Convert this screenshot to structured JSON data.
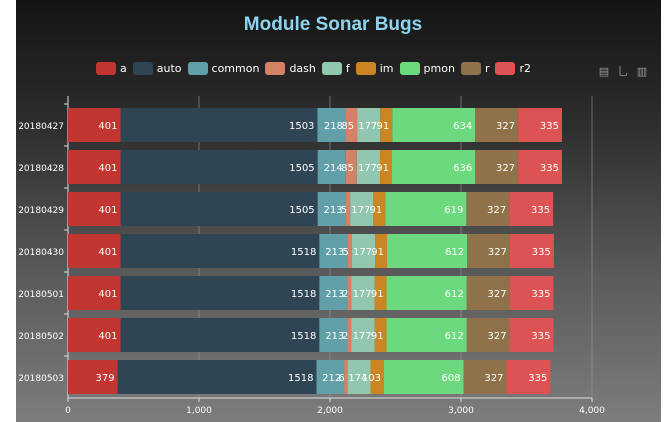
{
  "title": "Module Sonar Bugs",
  "toolbox": [
    {
      "name": "data-view-icon",
      "glyph": "▤"
    },
    {
      "name": "line-chart-icon",
      "glyph": "⺃"
    },
    {
      "name": "bar-chart-icon",
      "glyph": "▥"
    }
  ],
  "chart_data": {
    "type": "bar",
    "orientation": "horizontal",
    "stacked": true,
    "title": "Module Sonar Bugs",
    "categories": [
      "20180427",
      "20180428",
      "20180429",
      "20180430",
      "20180501",
      "20180502",
      "20180503"
    ],
    "xlim": [
      0,
      4000
    ],
    "x_ticks": [
      "0",
      "1,000",
      "2,000",
      "3,000",
      "4,000"
    ],
    "grid": true,
    "legend_position": "top",
    "series": [
      {
        "name": "a",
        "color": "#c23531",
        "values": [
          401,
          401,
          401,
          401,
          401,
          401,
          379
        ],
        "labels": [
          "401",
          "401",
          "401",
          "401",
          "401",
          "401",
          "379"
        ]
      },
      {
        "name": "auto",
        "color": "#2f4554",
        "values": [
          1503,
          1505,
          1505,
          1518,
          1518,
          1518,
          1518
        ],
        "labels": [
          "1503",
          "1505",
          "1505",
          "1518",
          "1518",
          "1518",
          "1518"
        ]
      },
      {
        "name": "common",
        "color": "#61a0a8",
        "values": [
          218,
          214,
          213,
          213,
          213,
          213,
          212
        ],
        "labels": [
          "218",
          "214",
          "213",
          "213",
          "213",
          "213",
          "212"
        ]
      },
      {
        "name": "dash",
        "color": "#d48265",
        "values": [
          85,
          85,
          35,
          35,
          32,
          32,
          26
        ],
        "labels": [
          "85",
          "85",
          "5",
          "5",
          "2",
          "2",
          "6"
        ]
      },
      {
        "name": "f",
        "color": "#91c7ae",
        "values": [
          177,
          177,
          177,
          177,
          177,
          177,
          174
        ],
        "labels": [
          "177",
          "177",
          "177",
          "177",
          "177",
          "177",
          "174"
        ]
      },
      {
        "name": "im",
        "color": "#ca8622",
        "values": [
          91,
          91,
          91,
          91,
          91,
          91,
          103
        ],
        "labels": [
          "91",
          "91",
          "91",
          "91",
          "91",
          "91",
          "103"
        ]
      },
      {
        "name": "pmon",
        "color": "#6cd97e",
        "values": [
          634,
          636,
          619,
          612,
          612,
          612,
          608
        ],
        "labels": [
          "634",
          "636",
          "619",
          "612",
          "612",
          "612",
          "608"
        ]
      },
      {
        "name": "r",
        "color": "#8f7249",
        "values": [
          327,
          327,
          327,
          327,
          327,
          327,
          327
        ],
        "labels": [
          "327",
          "327",
          "327",
          "327",
          "327",
          "327",
          "327"
        ]
      },
      {
        "name": "r2",
        "color": "#dd5353",
        "values": [
          335,
          335,
          335,
          335,
          335,
          335,
          335
        ],
        "labels": [
          "335",
          "335",
          "335",
          "335",
          "335",
          "335",
          "335"
        ]
      }
    ]
  }
}
